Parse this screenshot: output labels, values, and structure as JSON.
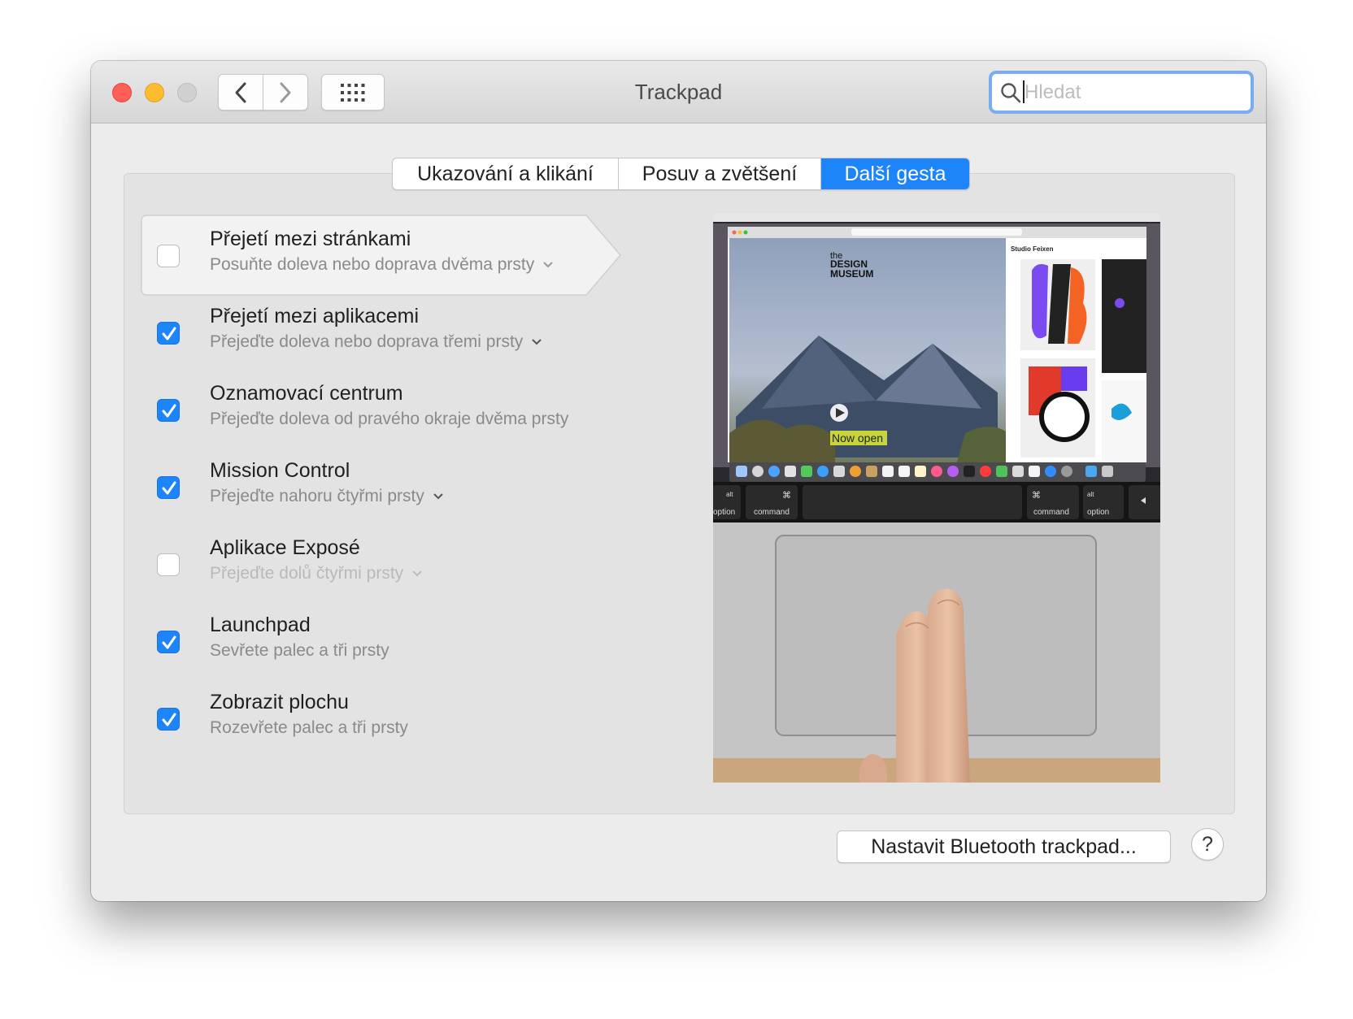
{
  "window": {
    "title": "Trackpad",
    "search_placeholder": "Hledat"
  },
  "tabs": [
    {
      "label": "Ukazování a klikání"
    },
    {
      "label": "Posuv a zvětšení"
    },
    {
      "label": "Další gesta",
      "selected": true
    }
  ],
  "gestures": [
    {
      "title": "Přejetí mezi stránkami",
      "subtitle": "Posuňte doleva nebo doprava dvěma prsty",
      "checked": false,
      "has_menu": true
    },
    {
      "title": "Přejetí mezi aplikacemi",
      "subtitle": "Přejeďte doleva nebo doprava třemi prsty",
      "checked": true,
      "has_menu": true
    },
    {
      "title": "Oznamovací centrum",
      "subtitle": "Přejeďte doleva od pravého okraje dvěma prsty",
      "checked": true,
      "has_menu": false
    },
    {
      "title": "Mission Control",
      "subtitle": "Přejeďte nahoru čtyřmi prsty",
      "checked": true,
      "has_menu": true
    },
    {
      "title": "Aplikace Exposé",
      "subtitle": "Přejeďte dolů čtyřmi prsty",
      "checked": false,
      "has_menu": true
    },
    {
      "title": "Launchpad",
      "subtitle": "Sevřete palec a tři prsty",
      "checked": true,
      "has_menu": false
    },
    {
      "title": "Zobrazit plochu",
      "subtitle": "Rozevřete palec a tři prsty",
      "checked": true,
      "has_menu": false
    }
  ],
  "preview": {
    "brand_line1": "the",
    "brand_line2": "DESIGN",
    "brand_line3": "MUSEUM",
    "banner": "Now open",
    "side_title": "Studio Feixen",
    "key_alt": "alt",
    "key_option": "option",
    "key_cmd_symbol": "⌘",
    "key_command": "command"
  },
  "footer": {
    "bluetooth_button": "Nastavit Bluetooth trackpad...",
    "help_button": "?"
  },
  "colors": {
    "accent": "#1d84fa",
    "close": "#ff5f57",
    "minimize": "#febc2e"
  }
}
